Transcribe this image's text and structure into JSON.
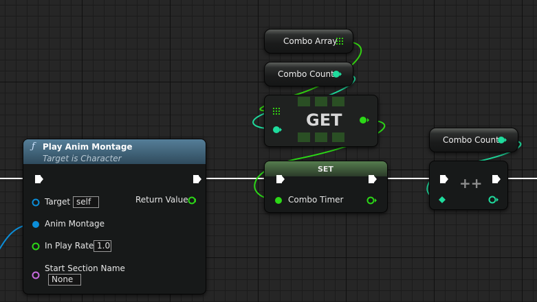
{
  "colors": {
    "exec_wire": "#ffffff",
    "array_wire": "#33d111",
    "int_wire": "#1fdc9d",
    "float_wire": "#2cd817",
    "object_wire": "#0b8ed9",
    "string_wire": "#d16fe6",
    "function_title": "#4f7791"
  },
  "nodes": {
    "play_anim_montage": {
      "title": "Play Anim Montage",
      "subtitle": "Target is Character",
      "icon": "function-icon",
      "inputs": {
        "target": {
          "label": "Target",
          "default": "self"
        },
        "anim_montage": {
          "label": "Anim Montage"
        },
        "in_play_rate": {
          "label": "In Play Rate",
          "default": "1.0"
        },
        "start_section_name": {
          "label": "Start Section Name",
          "default": "None"
        }
      },
      "outputs": {
        "return_value": {
          "label": "Return Value"
        }
      }
    },
    "combo_array": {
      "label": "Combo Array",
      "icon": "array-grid-icon"
    },
    "combo_count_top": {
      "label": "Combo Count"
    },
    "get_node": {
      "label": "GET"
    },
    "set_node": {
      "title": "SET",
      "input_label": "Combo Timer"
    },
    "combo_count_right": {
      "label": "Combo Count"
    },
    "increment_node": {
      "label": "++"
    }
  }
}
